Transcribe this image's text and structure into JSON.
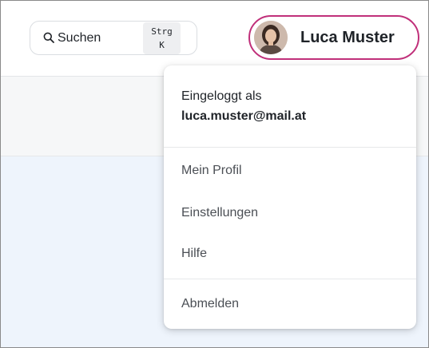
{
  "header": {
    "search": {
      "label": "Suchen",
      "shortcut_key1": "Strg",
      "shortcut_key2": "K",
      "icon": "search-icon"
    },
    "user": {
      "name": "Luca Muster",
      "avatar_icon": "avatar",
      "accent_color": "#c0307a"
    }
  },
  "user_menu": {
    "logged_in_label": "Eingeloggt als",
    "email": "luca.muster@mail.at",
    "items": [
      {
        "label": "Mein Profil"
      },
      {
        "label": "Einstellungen"
      },
      {
        "label": "Hilfe"
      }
    ],
    "logout_label": "Abmelden"
  }
}
